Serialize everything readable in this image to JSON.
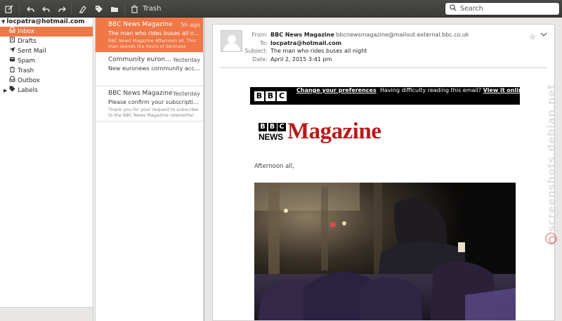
{
  "toolbar": {
    "trash_label": "Trash"
  },
  "search": {
    "placeholder": "Search"
  },
  "folders": {
    "account": "locpatra@hotmail.com",
    "items": [
      {
        "label": "Inbox",
        "icon": "inbox-icon",
        "selected": true
      },
      {
        "label": "Drafts",
        "icon": "drafts-icon"
      },
      {
        "label": "Sent Mail",
        "icon": "sent-icon"
      },
      {
        "label": "Spam",
        "icon": "spam-icon"
      },
      {
        "label": "Trash",
        "icon": "trash-icon"
      },
      {
        "label": "Outbox",
        "icon": "outbox-icon"
      }
    ],
    "labels": "Labels"
  },
  "messages": [
    {
      "sender": "BBC News Magazine",
      "time": "5h ago",
      "subject": "The man who rides buses all night",
      "preview": "BBC News Magazine Afternoon all, This man spends the hours of darkness riding ..."
    },
    {
      "sender": "Community euronews",
      "time": "Yesterday",
      "subject": "New euronews community account in...",
      "preview": ""
    },
    {
      "sender": "BBC News Magazine",
      "time": "Yesterday",
      "subject": "Please confirm your subscription to t...",
      "preview": "Thank you for your request to subscribe to the BBC News Magazine newsletter. To c..."
    }
  ],
  "viewer": {
    "from_label": "From:",
    "from_name": "BBC News Magazine",
    "from_email": "bbcnewsmagazine@mailout.external.bbc.co.uk",
    "to_label": "To:",
    "to_value": "locpatra@hotmail.com",
    "subject_label": "Subject:",
    "subject_value": "The man who rides buses all night",
    "date_label": "Date:",
    "date_value": "April 2, 2015 3:41 pm"
  },
  "email_body": {
    "bbc_letters": [
      "B",
      "B",
      "C"
    ],
    "change_prefs": "Change your preferences",
    "difficulty_text": "Having difficulty reading this email?",
    "view_online": "View it online",
    "brand_news": "NEWS",
    "brand_magazine": "Magazine",
    "greeting": "Afternoon all,"
  },
  "watermark": "screenshots.debian.net"
}
